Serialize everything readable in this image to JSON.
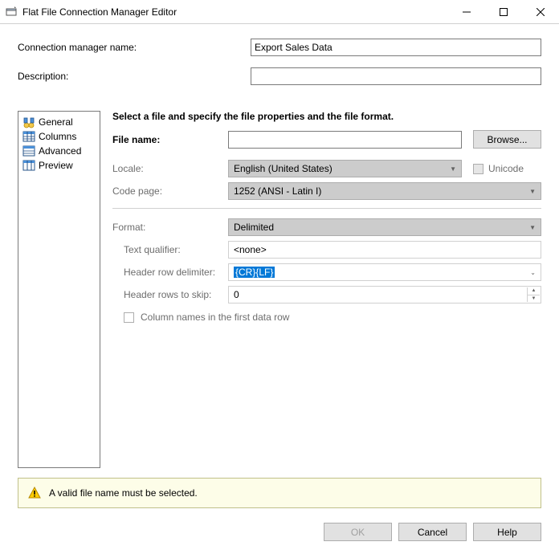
{
  "window": {
    "title": "Flat File Connection Manager Editor"
  },
  "header": {
    "name_label": "Connection manager name:",
    "name_value": "Export Sales Data",
    "desc_label": "Description:",
    "desc_value": ""
  },
  "sidebar": {
    "items": [
      {
        "label": "General"
      },
      {
        "label": "Columns"
      },
      {
        "label": "Advanced"
      },
      {
        "label": "Preview"
      }
    ]
  },
  "main": {
    "instruction": "Select a file and specify the file properties and the file format.",
    "file_label": "File name:",
    "file_value": "",
    "browse": "Browse...",
    "locale_label": "Locale:",
    "locale_value": "English (United States)",
    "unicode_label": "Unicode",
    "codepage_label": "Code page:",
    "codepage_value": "1252  (ANSI - Latin I)",
    "format_label": "Format:",
    "format_value": "Delimited",
    "textqual_label": "Text qualifier:",
    "textqual_value": "<none>",
    "hdr_delim_label": "Header row delimiter:",
    "hdr_delim_value": "{CR}{LF}",
    "hdr_skip_label": "Header rows to skip:",
    "hdr_skip_value": "0",
    "colnames_label": "Column names in the first data row"
  },
  "warning": {
    "text": "A valid file name must be selected."
  },
  "footer": {
    "ok": "OK",
    "cancel": "Cancel",
    "help": "Help"
  }
}
